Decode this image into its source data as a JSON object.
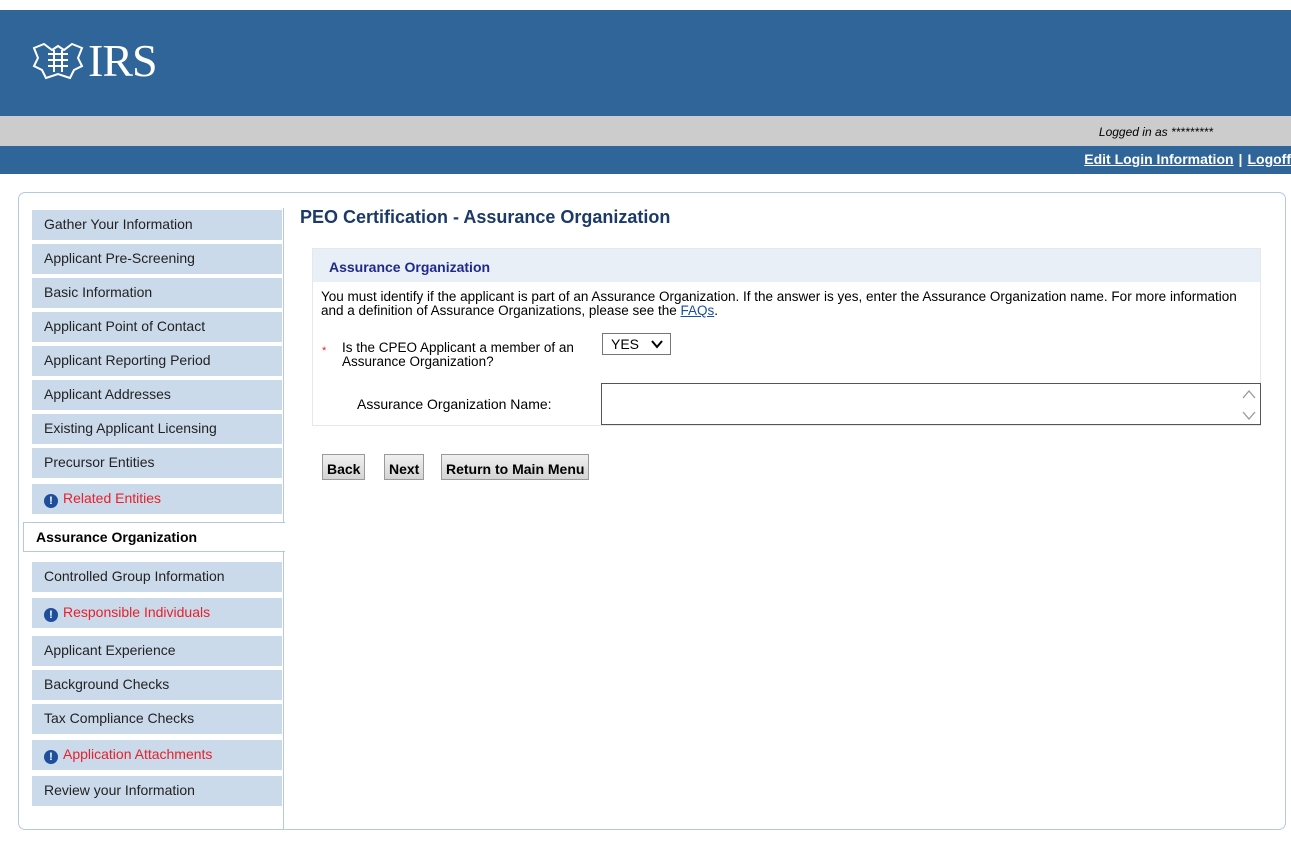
{
  "header": {
    "logo_text": "IRS",
    "logged_in_text": "Logged in as *********",
    "links": {
      "edit_login": "Edit Login Information",
      "separator": "|",
      "logoff": "Logoff"
    }
  },
  "sidebar": {
    "items": [
      {
        "label": "Gather Your Information",
        "status": "normal"
      },
      {
        "label": "Applicant Pre-Screening",
        "status": "normal"
      },
      {
        "label": "Basic Information",
        "status": "normal"
      },
      {
        "label": "Applicant Point of Contact",
        "status": "normal"
      },
      {
        "label": "Applicant Reporting Period",
        "status": "normal"
      },
      {
        "label": "Applicant Addresses",
        "status": "normal"
      },
      {
        "label": "Existing Applicant Licensing",
        "status": "normal"
      },
      {
        "label": "Precursor Entities",
        "status": "normal"
      },
      {
        "label": "Related Entities",
        "status": "alert"
      },
      {
        "label": "Assurance Organization",
        "status": "active"
      },
      {
        "label": "Controlled Group Information",
        "status": "normal"
      },
      {
        "label": "Responsible Individuals",
        "status": "alert"
      },
      {
        "label": "Applicant Experience",
        "status": "normal"
      },
      {
        "label": "Background Checks",
        "status": "normal"
      },
      {
        "label": "Tax Compliance Checks",
        "status": "normal"
      },
      {
        "label": "Application Attachments",
        "status": "alert"
      },
      {
        "label": "Review your Information",
        "status": "normal"
      }
    ]
  },
  "main": {
    "title": "PEO Certification - Assurance Organization",
    "panel": {
      "title": "Assurance Organization",
      "desc_text": "You must identify if the applicant is part of an Assurance Organization. If the answer is yes, enter the Assurance Organization name. For more information and a definition of Assurance Organizations, please see the",
      "faq_link": "FAQs",
      "desc_end": ".",
      "required_mark": "*",
      "question": "Is the CPEO Applicant a member of an Assurance Organization?",
      "select_value": "YES",
      "name_label": "Assurance Organization Name:",
      "name_value": ""
    },
    "buttons": {
      "back": "Back",
      "next": "Next",
      "return": "Return to Main Menu"
    }
  },
  "colors": {
    "header_blue": "#2f6598",
    "nav_bg": "#cbdaea",
    "alert_red": "#e8202a",
    "title_navy": "#1c3a67"
  }
}
